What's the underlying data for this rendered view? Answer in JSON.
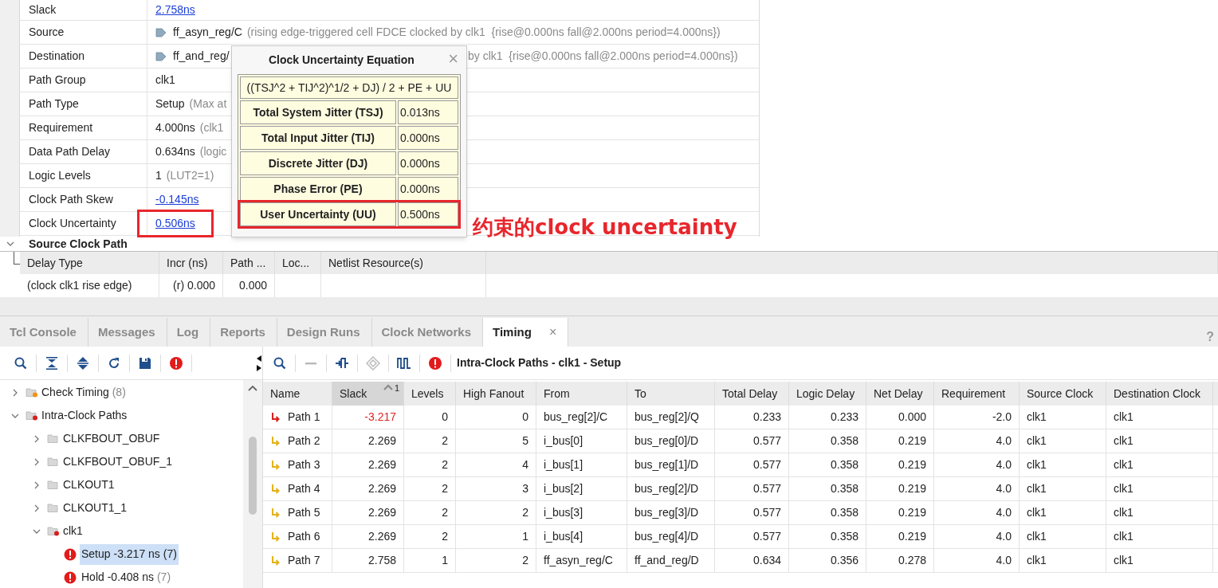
{
  "properties": [
    {
      "label": "Slack",
      "value": "2.758ns",
      "link": true
    },
    {
      "label": "Source",
      "value": "ff_asyn_reg/C",
      "pin": true,
      "note": "(rising edge-triggered cell FDCE clocked by clk1  {rise@0.000ns fall@2.000ns period=4.000ns})"
    },
    {
      "label": "Destination",
      "value": "ff_and_reg/",
      "pin": true,
      "tail": "by clk1  {rise@0.000ns fall@2.000ns period=4.000ns})"
    },
    {
      "label": "Path Group",
      "value": "clk1"
    },
    {
      "label": "Path Type",
      "value": "Setup",
      "note": "(Max at"
    },
    {
      "label": "Requirement",
      "value": "4.000ns",
      "note": "(clk1"
    },
    {
      "label": "Data Path Delay",
      "value": "0.634ns",
      "note": "(logic"
    },
    {
      "label": "Logic Levels",
      "value": "1",
      "note": "(LUT2=1)"
    },
    {
      "label": "Clock Path Skew",
      "value": "-0.145ns",
      "link": true
    },
    {
      "label": "Clock Uncertainty",
      "value": "0.506ns",
      "link": true,
      "highlighted": true
    }
  ],
  "popup": {
    "title": "Clock Uncertainty Equation",
    "close": "×",
    "formula": "((TSJ^2 + TIJ^2)^1/2 + DJ) / 2 + PE + UU",
    "rows": [
      {
        "label": "Total System Jitter (TSJ)",
        "value": "0.013ns",
        "highlighted": false
      },
      {
        "label": "Total Input Jitter (TIJ)",
        "value": "0.000ns",
        "highlighted": false
      },
      {
        "label": "Discrete Jitter (DJ)",
        "value": "0.000ns",
        "highlighted": false
      },
      {
        "label": "Phase Error (PE)",
        "value": "0.000ns",
        "highlighted": false
      },
      {
        "label": "User Uncertainty (UU)",
        "value": "0.500ns",
        "highlighted": true
      }
    ]
  },
  "annotation": {
    "text": "约束的clock uncertainty"
  },
  "source_clock_path": {
    "title": "Source Clock Path",
    "expanded": true,
    "columns": [
      "Delay Type",
      "Incr (ns)",
      "Path ...",
      "Loc...",
      "Netlist Resource(s)"
    ],
    "rows": [
      [
        "(clock clk1 rise edge)",
        "(r) 0.000",
        "0.000"
      ]
    ]
  },
  "tabs": [
    {
      "label": "Tcl Console",
      "selected": false
    },
    {
      "label": "Messages",
      "selected": false
    },
    {
      "label": "Log",
      "selected": false
    },
    {
      "label": "Reports",
      "selected": false
    },
    {
      "label": "Design Runs",
      "selected": false
    },
    {
      "label": "Clock Networks",
      "selected": false
    },
    {
      "label": "Timing",
      "selected": true,
      "close": "×"
    }
  ],
  "help": "?",
  "left_toolbar": [
    {
      "kind": "search",
      "disabled": false
    },
    {
      "kind": "collapse",
      "disabled": false
    },
    {
      "kind": "expand",
      "disabled": false
    },
    {
      "kind": "refresh",
      "disabled": false
    },
    {
      "kind": "save",
      "disabled": false
    },
    {
      "kind": "error",
      "disabled": false
    }
  ],
  "right_toolbar": [
    {
      "kind": "search",
      "disabled": false
    },
    {
      "kind": "minus",
      "disabled": true
    },
    {
      "kind": "schematic",
      "disabled": false
    },
    {
      "kind": "diamond",
      "disabled": true
    },
    {
      "kind": "waveform",
      "disabled": false
    },
    {
      "kind": "error",
      "disabled": false
    }
  ],
  "report_title": "Intra-Clock Paths - clk1 - Setup",
  "tree": [
    {
      "kind": "folder_warning",
      "label": "Check Timing",
      "count": "(8)",
      "expanded": false,
      "selected": false
    },
    {
      "kind": "folder_error",
      "label": "Intra-Clock Paths",
      "expanded": true,
      "selected": false,
      "children": [
        {
          "kind": "folder",
          "label": "CLKFBOUT_OBUF",
          "expanded": false,
          "selected": false
        },
        {
          "kind": "folder",
          "label": "CLKFBOUT_OBUF_1",
          "expanded": false,
          "selected": false
        },
        {
          "kind": "folder",
          "label": "CLKOUT1",
          "expanded": false,
          "selected": false
        },
        {
          "kind": "folder",
          "label": "CLKOUT1_1",
          "expanded": false,
          "selected": false
        },
        {
          "kind": "folder_error",
          "label": "clk1",
          "expanded": true,
          "selected": false,
          "children": [
            {
              "kind": "error_result",
              "label": "Setup -3.217 ns",
              "count": "(7)",
              "selected": true
            },
            {
              "kind": "error_result",
              "label": "Hold -0.408 ns",
              "count": "(7)",
              "selected": false
            }
          ]
        }
      ]
    }
  ],
  "paths_table": {
    "columns": [
      {
        "label": "Name",
        "sorted": false
      },
      {
        "label": "Slack",
        "sorted": true,
        "sort_rank": "1"
      },
      {
        "label": "Levels",
        "sorted": false
      },
      {
        "label": "High Fanout",
        "sorted": false
      },
      {
        "label": "From",
        "sorted": false
      },
      {
        "label": "To",
        "sorted": false
      },
      {
        "label": "Total Delay",
        "sorted": false
      },
      {
        "label": "Logic Delay",
        "sorted": false
      },
      {
        "label": "Net Delay",
        "sorted": false
      },
      {
        "label": "Requirement",
        "sorted": false
      },
      {
        "label": "Source Clock",
        "sorted": false
      },
      {
        "label": "Destination Clock",
        "sorted": false
      }
    ],
    "rows": [
      {
        "failing": true,
        "cells": [
          "Path 1",
          "-3.217",
          "0",
          "0",
          "bus_reg[2]/C",
          "bus_reg[2]/Q",
          "0.233",
          "0.233",
          "0.000",
          "-2.0",
          "clk1",
          "clk1"
        ]
      },
      {
        "failing": false,
        "cells": [
          "Path 2",
          "2.269",
          "2",
          "5",
          "i_bus[0]",
          "bus_reg[0]/D",
          "0.577",
          "0.358",
          "0.219",
          "4.0",
          "clk1",
          "clk1"
        ]
      },
      {
        "failing": false,
        "cells": [
          "Path 3",
          "2.269",
          "2",
          "4",
          "i_bus[1]",
          "bus_reg[1]/D",
          "0.577",
          "0.358",
          "0.219",
          "4.0",
          "clk1",
          "clk1"
        ]
      },
      {
        "failing": false,
        "cells": [
          "Path 4",
          "2.269",
          "2",
          "3",
          "i_bus[2]",
          "bus_reg[2]/D",
          "0.577",
          "0.358",
          "0.219",
          "4.0",
          "clk1",
          "clk1"
        ]
      },
      {
        "failing": false,
        "cells": [
          "Path 5",
          "2.269",
          "2",
          "2",
          "i_bus[3]",
          "bus_reg[3]/D",
          "0.577",
          "0.358",
          "0.219",
          "4.0",
          "clk1",
          "clk1"
        ]
      },
      {
        "failing": false,
        "cells": [
          "Path 6",
          "2.269",
          "2",
          "1",
          "i_bus[4]",
          "bus_reg[4]/D",
          "0.577",
          "0.358",
          "0.219",
          "4.0",
          "clk1",
          "clk1"
        ]
      },
      {
        "failing": false,
        "cells": [
          "Path 7",
          "2.758",
          "1",
          "2",
          "ff_asyn_reg/C",
          "ff_and_reg/D",
          "0.634",
          "0.356",
          "0.278",
          "4.0",
          "clk1",
          "clk1"
        ]
      }
    ]
  }
}
